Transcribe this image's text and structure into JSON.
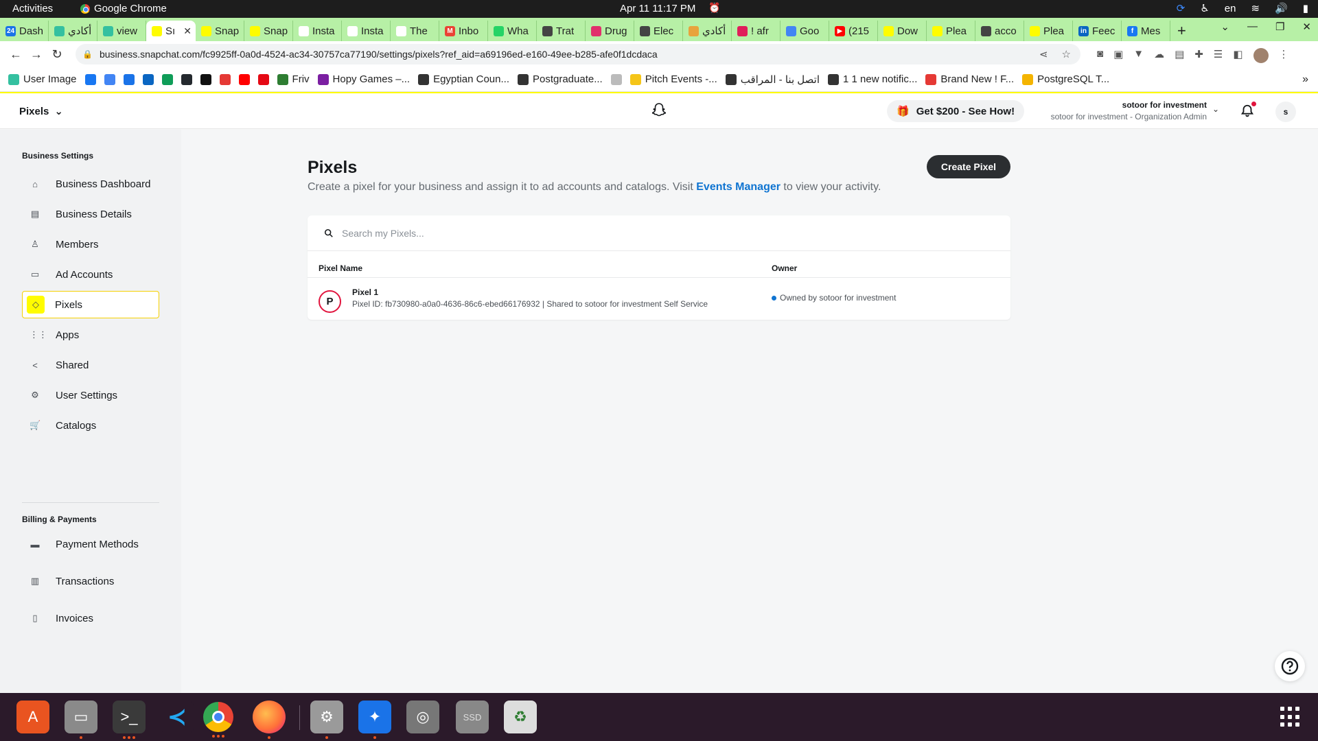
{
  "system": {
    "activities": "Activities",
    "app_name": "Google Chrome",
    "clock": "Apr 11  11:17 PM",
    "lang": "en"
  },
  "tabs": [
    {
      "label": "Dash",
      "color": "#1a73e8",
      "icon": "24"
    },
    {
      "label": "أكادي",
      "color": "#34c0a0",
      "icon": ""
    },
    {
      "label": "view",
      "color": "#34c0a0",
      "icon": ""
    },
    {
      "label": "Sı",
      "color": "#fffc00",
      "icon": "",
      "active": true
    },
    {
      "label": "Snap",
      "color": "#fffc00",
      "icon": ""
    },
    {
      "label": "Snap",
      "color": "#fffc00",
      "icon": ""
    },
    {
      "label": "Insta",
      "color": "#ffffff",
      "icon": ""
    },
    {
      "label": "Insta",
      "color": "#ffffff",
      "icon": ""
    },
    {
      "label": "The",
      "color": "#ffffff",
      "icon": ""
    },
    {
      "label": "Inbo",
      "color": "#ea4335",
      "icon": "M"
    },
    {
      "label": "Wha",
      "color": "#25d366",
      "icon": ""
    },
    {
      "label": "Trat",
      "color": "#444444",
      "icon": ""
    },
    {
      "label": "Drug",
      "color": "#e1306c",
      "icon": ""
    },
    {
      "label": "Elec",
      "color": "#444444",
      "icon": ""
    },
    {
      "label": "أكادي",
      "color": "#e8a33d",
      "icon": ""
    },
    {
      "label": "! afr",
      "color": "#e01e5a",
      "icon": ""
    },
    {
      "label": "Goo",
      "color": "#4285f4",
      "icon": ""
    },
    {
      "label": "(215",
      "color": "#ff0000",
      "icon": "▶"
    },
    {
      "label": "Dow",
      "color": "#fffc00",
      "icon": ""
    },
    {
      "label": "Plea",
      "color": "#fffc00",
      "icon": ""
    },
    {
      "label": "acco",
      "color": "#444444",
      "icon": ""
    },
    {
      "label": "Plea",
      "color": "#fffc00",
      "icon": ""
    },
    {
      "label": "Feec",
      "color": "#0a66c2",
      "icon": "in"
    },
    {
      "label": "Mes",
      "color": "#1877f2",
      "icon": "f"
    }
  ],
  "address_bar": {
    "url": "business.snapchat.com/fc9925ff-0a0d-4524-ac34-30757ca77190/settings/pixels?ref_aid=a69196ed-e160-49ee-b285-afe0f1dcdaca"
  },
  "bookmarks": [
    {
      "label": "User Image",
      "color": "#34c0a0"
    },
    {
      "label": "",
      "color": "#1877f2"
    },
    {
      "label": "",
      "color": "#4285f4"
    },
    {
      "label": "",
      "color": "#1a73e8"
    },
    {
      "label": "",
      "color": "#0a66c2"
    },
    {
      "label": "",
      "color": "#0f9d58"
    },
    {
      "label": "",
      "color": "#24292e"
    },
    {
      "label": "",
      "color": "#111111"
    },
    {
      "label": "",
      "color": "#e53935"
    },
    {
      "label": "",
      "color": "#ff0000"
    },
    {
      "label": "",
      "color": "#e50914"
    },
    {
      "label": "Friv",
      "color": "#2e7d32"
    },
    {
      "label": "Hopy Games –...",
      "color": "#7b1fa2"
    },
    {
      "label": "Egyptian Coun...",
      "color": "#333333"
    },
    {
      "label": "Postgraduate...",
      "color": "#333333"
    },
    {
      "label": "",
      "color": "#bbbbbb"
    },
    {
      "label": "Pitch Events -...",
      "color": "#f5c518"
    },
    {
      "label": "اتصل بنا - المراقب",
      "color": "#333333"
    },
    {
      "label": "1 1 new notific...",
      "color": "#333333"
    },
    {
      "label": "Brand New ! F...",
      "color": "#e53935"
    },
    {
      "label": "PostgreSQL T...",
      "color": "#f4b400"
    }
  ],
  "header": {
    "app_switch": "Pixels",
    "promo": "Get $200 - See How!",
    "org_name": "sotoor for investment",
    "org_role": "sotoor for investment - Organization Admin",
    "user_initial": "s"
  },
  "sidebar": {
    "section1": "Business Settings",
    "items": [
      {
        "label": "Business Dashboard",
        "icon": "⌂"
      },
      {
        "label": "Business Details",
        "icon": "▤"
      },
      {
        "label": "Members",
        "icon": "♙"
      },
      {
        "label": "Ad Accounts",
        "icon": "▭"
      },
      {
        "label": "Pixels",
        "icon": "◇",
        "active": true
      },
      {
        "label": "Apps",
        "icon": "⋮⋮"
      },
      {
        "label": "Shared",
        "icon": "<"
      },
      {
        "label": "User Settings",
        "icon": "⚙"
      },
      {
        "label": "Catalogs",
        "icon": "🛒"
      }
    ],
    "section2": "Billing & Payments",
    "items2": [
      {
        "label": "Payment Methods",
        "icon": "▬"
      },
      {
        "label": "Transactions",
        "icon": "▥"
      },
      {
        "label": "Invoices",
        "icon": "▯"
      }
    ]
  },
  "main": {
    "title": "Pixels",
    "subtitle_before": "Create a pixel for your business and assign it to ad accounts and catalogs. Visit ",
    "subtitle_link": "Events Manager",
    "subtitle_after": " to view your activity.",
    "create_button": "Create Pixel",
    "search_placeholder": "Search my Pixels...",
    "columns": [
      "Pixel Name",
      "Owner"
    ],
    "rows": [
      {
        "initial": "P",
        "name": "Pixel 1",
        "meta": "Pixel ID: fb730980-a0a0-4636-86c6-ebed66176932 | Shared to sotoor for investment Self Service",
        "owner": "Owned by sotoor for investment"
      }
    ]
  },
  "dock": [
    {
      "name": "app-center",
      "color": "#e95420",
      "glyph": "A",
      "dots": 0
    },
    {
      "name": "files",
      "color": "#8a8a8a",
      "glyph": "▭",
      "dots": 1
    },
    {
      "name": "terminal",
      "color": "#3a3a3a",
      "glyph": ">_",
      "dots": 3
    },
    {
      "name": "vscode",
      "color": "#2b1a2a",
      "glyph": "≺",
      "dots": 0
    },
    {
      "name": "chrome",
      "color": "#4285f4",
      "glyph": "",
      "dots": 3
    },
    {
      "name": "firefox",
      "color": "#ff7139",
      "glyph": "",
      "dots": 1
    },
    {
      "name": "settings",
      "color": "#9a9a9a",
      "glyph": "⚙",
      "dots": 1
    },
    {
      "name": "blue-app",
      "color": "#1a73e8",
      "glyph": "✦",
      "dots": 1
    },
    {
      "name": "disk-app",
      "color": "#777777",
      "glyph": "◎",
      "dots": 0
    },
    {
      "name": "ssd",
      "color": "#888888",
      "glyph": "SSD",
      "dots": 0
    },
    {
      "name": "trash",
      "color": "#dddddd",
      "glyph": "♻",
      "dots": 0
    }
  ]
}
